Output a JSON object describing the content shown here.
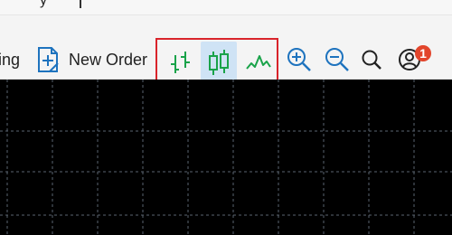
{
  "top_partial": "y",
  "toolbar": {
    "left_partial_label": "ing",
    "new_order_label": "New Order",
    "chart_types": [
      {
        "name": "bar-chart",
        "icon": "bar-chart-icon",
        "active": false
      },
      {
        "name": "candlestick-chart",
        "icon": "candlestick-chart-icon",
        "active": true
      },
      {
        "name": "line-chart",
        "icon": "line-chart-icon",
        "active": false
      }
    ],
    "zoom_in_icon": "zoom-in-icon",
    "zoom_out_icon": "zoom-out-icon",
    "search_icon": "search-icon",
    "account_icon": "user-account-icon",
    "notification_count": "1"
  },
  "colors": {
    "chart_green": "#1aa34a",
    "blue_icon": "#1e73be",
    "highlight_border": "#d9242b",
    "active_button_bg": "#cfe3f5",
    "badge": "#e2452b",
    "chart_background": "#000000",
    "grid": "#5a6470"
  }
}
